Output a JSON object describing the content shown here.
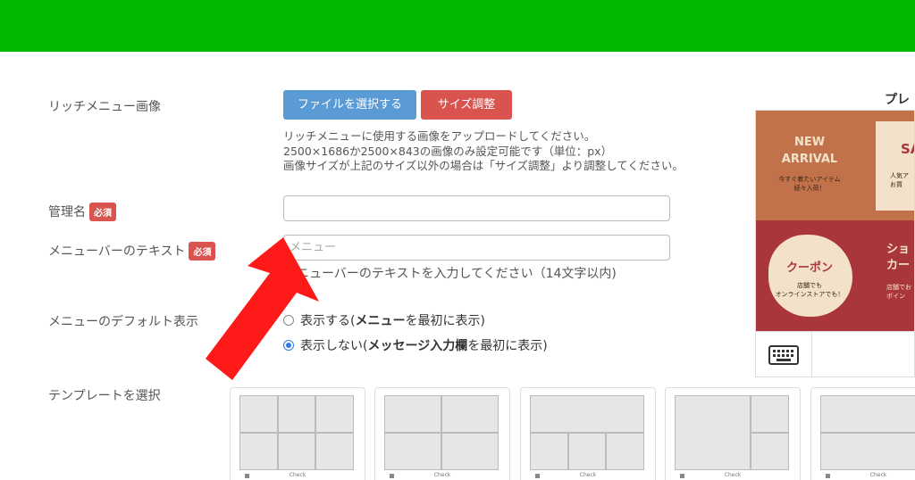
{
  "header": {
    "color": "#00b900"
  },
  "form": {
    "image_label": "リッチメニュー画像",
    "file_button": "ファイルを選択する",
    "resize_button": "サイズ調整",
    "help_lines": [
      "リッチメニューに使用する画像をアップロードしてください。",
      "2500×1686か2500×843の画像のみ設定可能です（単位：px）",
      "画像サイズが上記のサイズ以外の場合は「サイズ調整」より調整してください。"
    ],
    "name_label": "管理名",
    "required_badge": "必須",
    "name_value": "",
    "menubar_label": "メニューバーのテキスト",
    "menubar_placeholder": "メニュー",
    "menubar_hint": "ニューバーのテキストを入力してください（14文字以内)",
    "default_label": "メニューのデフォルト表示",
    "option_show_prefix": "表示する(",
    "option_show_bold": "メニュー",
    "option_show_suffix": "を最初に表示)",
    "option_hide_prefix": "表示しない(",
    "option_hide_bold": "メッセージ入力欄",
    "option_hide_suffix": "を最初に表示)",
    "template_label": "テンプレートを選択",
    "template_check": "Check"
  },
  "preview": {
    "title": "プレ",
    "tiles": {
      "new_arrival": "NEW\nARRIVAL",
      "new_arrival_sub": "今すぐ着たいアイテム\n続々入荷！",
      "sale": "SA",
      "sale_sub": "人気ア\nお買",
      "coupon": "クーポン",
      "coupon_sub": "店舗でも\nオンラインストアでも！",
      "shop": "ショ\nカー",
      "shop_sub": "店舗でお\nポイン"
    },
    "keyboard_icon": "keyboard-icon"
  },
  "colors": {
    "arrow": "#ff1a1a",
    "tile_orange": "#c1724a",
    "tile_cream": "#f3e2c9",
    "tile_red": "#a9363b"
  }
}
